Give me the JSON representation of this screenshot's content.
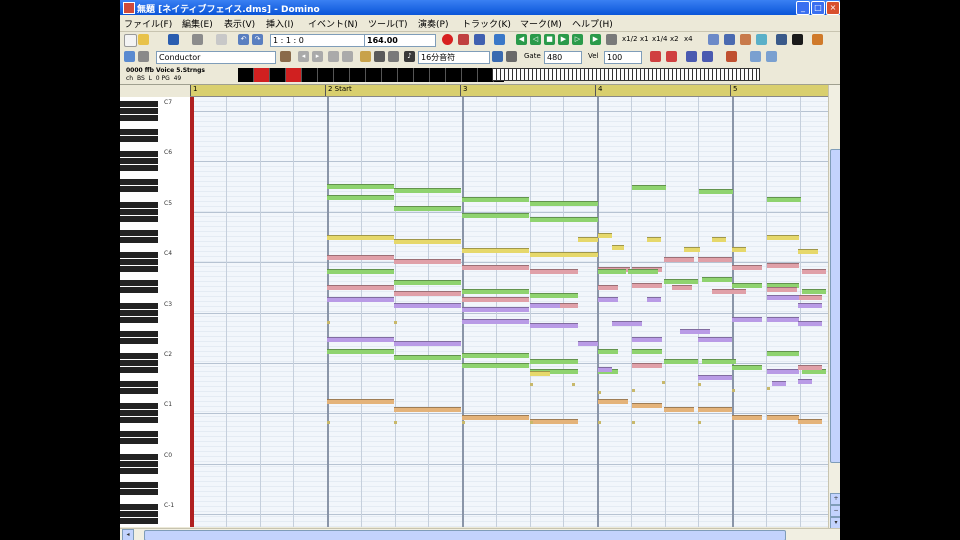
{
  "window": {
    "title": "無題 [ネイティブフェイス.dms] - Domino"
  },
  "menu": [
    "ファイル(F)",
    "編集(E)",
    "表示(V)",
    "挿入(I)",
    "イベント(N)",
    "ツール(T)",
    "演奏(P)",
    "トラック(K)",
    "マーク(M)",
    "ヘルプ(H)"
  ],
  "toolbar": {
    "position": "1 : 1 : 0",
    "tempo": "164.00",
    "track_select": "Conductor",
    "note_length": "16分音符",
    "gate_label": "Gate",
    "gate_value": "480",
    "vel_label": "Vel",
    "vel_value": "100",
    "zoom_labels": [
      "x1/2",
      "x1",
      "x1/4",
      "x2",
      "x4"
    ]
  },
  "track_info": {
    "name": "0000 ffb Voice 5.Strngs",
    "sub": [
      "ch",
      "BS",
      "L",
      "0 PG",
      "49"
    ]
  },
  "ruler": {
    "measures": [
      {
        "label": "1"
      },
      {
        "label": "2 Start"
      },
      {
        "label": "3"
      },
      {
        "label": "4"
      },
      {
        "label": "5"
      }
    ]
  },
  "keyboard": {
    "octave_labels": [
      "C7",
      "C6",
      "C5",
      "C4",
      "C3",
      "C2",
      "C1",
      "C0",
      "C-1"
    ]
  },
  "colors": {
    "green": "#8fd36f",
    "yellow": "#e6d86b",
    "pink": "#e0a0a8",
    "purple": "#b99be6",
    "orange": "#e4b37a"
  }
}
